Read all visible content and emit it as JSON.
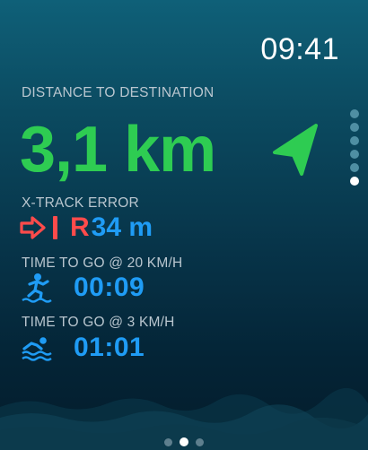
{
  "status": {
    "time": "09:41"
  },
  "distance": {
    "label": "DISTANCE TO DESTINATION",
    "value": "3,1 km",
    "icon": "navigation-arrow-icon",
    "color": "#2ecc52"
  },
  "xtrack": {
    "label": "X-TRACK ERROR",
    "icon": "right-arrow-to-line-icon",
    "side": "R",
    "value": "34 m",
    "side_color": "#ff4b4b",
    "value_color": "#1f9cf5"
  },
  "ttg_fast": {
    "label": "TIME TO GO @ 20 KM/H",
    "icon": "surfing-icon",
    "value": "00:09"
  },
  "ttg_slow": {
    "label": "TIME TO GO @ 3 KM/H",
    "icon": "swimming-icon",
    "value": "01:01"
  },
  "pager_vertical": {
    "count": 6,
    "active_index": 5
  },
  "pager_horizontal": {
    "count": 3,
    "active_index": 1
  }
}
